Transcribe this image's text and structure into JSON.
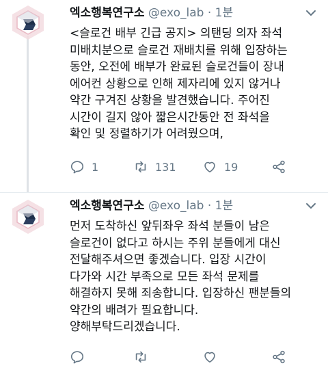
{
  "tweets": [
    {
      "display_name": "엑소행복연구소",
      "handle": "@exo_lab",
      "separator": "·",
      "time": "1분",
      "lines": [
        "<슬로건 배부 긴급 공지> 의탠딩 의자 좌석",
        "미배치분으로 슬로건 재배치를 위해 입장하는",
        "동안, 오전에 배부가 완료된 슬로건들이 장내",
        "에어컨 상황으로 인해 제자리에 있지 않거나",
        "약간 구겨진 상황을 발견했습니다. 주어진",
        "시간이 길지 않아 짧은시간동안 전 좌석을",
        "확인 및 정렬하기가 어려웠으며,"
      ],
      "reply_count": "1",
      "retweet_count": "131",
      "like_count": "19"
    },
    {
      "display_name": "엑소행복연구소",
      "handle": "@exo_lab",
      "separator": "·",
      "time": "1분",
      "lines": [
        "먼저 도착하신 앞뒤좌우 좌석 분들이 남은",
        "슬로건이 없다고 하시는 주위 분들에게 대신",
        "전달해주셔으면 좋겠습니다. 입장 시간이",
        "다가와 시간 부족으로 모든 좌석 문제를",
        "해결하지 못해 죄송합니다. 입장하신 팬분들의",
        "약간의 배려가 필요합니다.",
        "양해부탁드리겠습니다."
      ],
      "reply_count": "",
      "retweet_count": "",
      "like_count": ""
    }
  ],
  "icons": {
    "reply": "reply-icon",
    "retweet": "retweet-icon",
    "like": "heart-icon",
    "share": "share-icon",
    "caret": "chevron-down-icon"
  },
  "colors": {
    "text": "#14171a",
    "muted": "#657786",
    "icon": "#657786",
    "divider": "#e6ecf0"
  }
}
